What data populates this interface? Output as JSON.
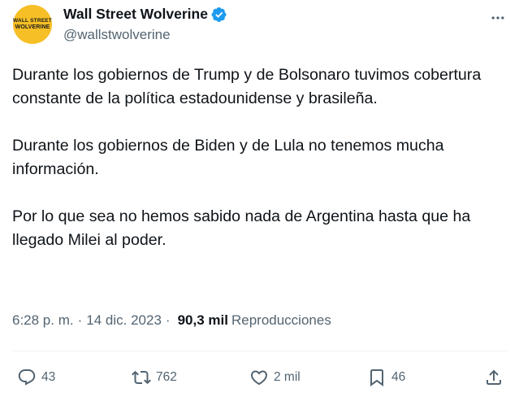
{
  "author": {
    "display_name": "Wall Street Wolverine",
    "handle": "@wallstwolverine",
    "avatar_line1": "WALL STREET",
    "avatar_line2": "WOLVERINE",
    "avatar_color": "#f6bf26",
    "verified_color": "#1d9bf0"
  },
  "tweet": {
    "paragraphs": [
      "Durante los gobiernos de Trump y de Bolsonaro tuvimos cobertura constante de la política estadounidense y brasileña.",
      "Durante los gobiernos de Biden y de Lula no tenemos mucha información.",
      "Por lo que sea no hemos sabido nada de Argentina hasta que ha llegado Milei al poder."
    ],
    "time": "6:28 p. m.",
    "separator": "·",
    "date": "14 dic. 2023",
    "views_count": "90,3 mil",
    "views_label": "Reproducciones"
  },
  "actions": {
    "replies": "43",
    "retweets": "762",
    "likes": "2 mil",
    "bookmarks": "46"
  },
  "icons": {
    "more": "more-icon",
    "reply": "reply-icon",
    "retweet": "retweet-icon",
    "like": "like-icon",
    "bookmark": "bookmark-icon",
    "share": "share-icon",
    "verified": "verified-badge-icon"
  }
}
